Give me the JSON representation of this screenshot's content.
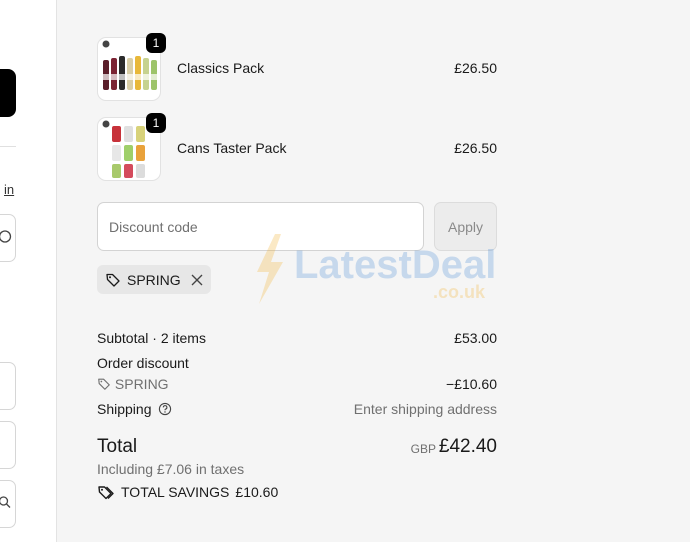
{
  "left_column": {
    "link_text": "in",
    "search_glyph": "search-icon"
  },
  "line_items": [
    {
      "name": "Classics Pack",
      "price": "£26.50",
      "quantity": "1"
    },
    {
      "name": "Cans Taster Pack",
      "price": "£26.50",
      "quantity": "1"
    }
  ],
  "discount": {
    "placeholder": "Discount code",
    "apply_label": "Apply",
    "applied_code": "SPRING"
  },
  "summary": {
    "subtotal_label": "Subtotal · 2 items",
    "subtotal_value": "£53.00",
    "order_discount_label": "Order discount",
    "order_discount_code": "SPRING",
    "order_discount_value": "−£10.60",
    "shipping_label": "Shipping",
    "shipping_value": "Enter shipping address",
    "total_label": "Total",
    "currency": "GBP",
    "total_value": "£42.40",
    "tax_note": "Including £7.06 in taxes",
    "savings_label": "TOTAL SAVINGS",
    "savings_value": "£10.60"
  },
  "watermark": {
    "brand": "LatestDeals",
    "domain": ".co.uk"
  },
  "colors": {
    "panel_bg": "#f5f5f5",
    "badge": "#000000",
    "muted_text": "#707070"
  }
}
